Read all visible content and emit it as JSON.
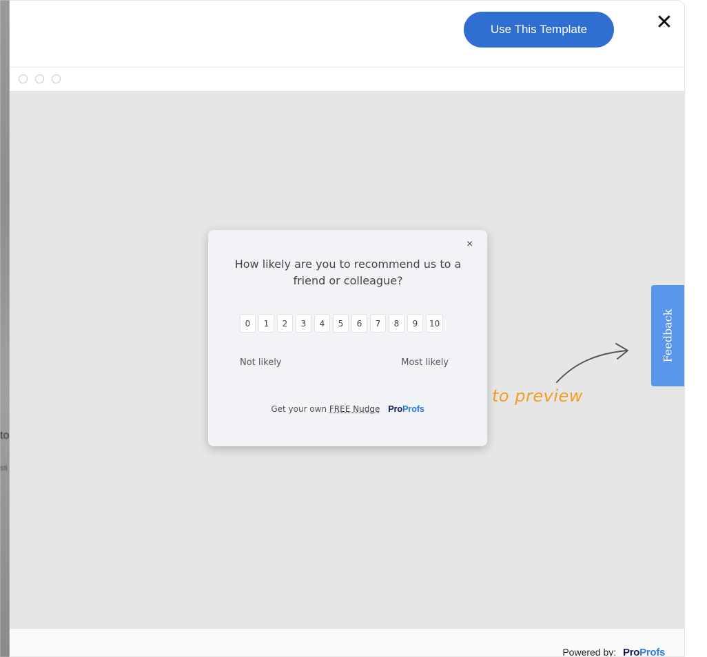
{
  "background": {
    "fragment_1": "to",
    "fragment_2": "sti"
  },
  "header": {
    "use_template_label": "Use This Template",
    "close_glyph": "✕"
  },
  "preview": {
    "hint_text": "to preview",
    "feedback_tab_label": "Feedback"
  },
  "nudge": {
    "close_glyph": "×",
    "question": "How likely are you to recommend us to a friend or colleague?",
    "scale": [
      "0",
      "1",
      "2",
      "3",
      "4",
      "5",
      "6",
      "7",
      "8",
      "9",
      "10"
    ],
    "label_low": "Not likely",
    "label_high": "Most likely",
    "footer_prefix": "Get your own",
    "footer_link": "FREE Nudge",
    "brand_pro": "Pro",
    "brand_profs": "Profs"
  },
  "footer": {
    "powered_by": "Powered by:",
    "brand_pro": "Pro",
    "brand_profs": "Profs"
  },
  "colors": {
    "primary_button": "#2f6fd1",
    "feedback_tab": "#5a95ec",
    "hint_orange": "#f0a020",
    "brand_dark": "#111a5c",
    "brand_blue": "#2a7de1"
  }
}
